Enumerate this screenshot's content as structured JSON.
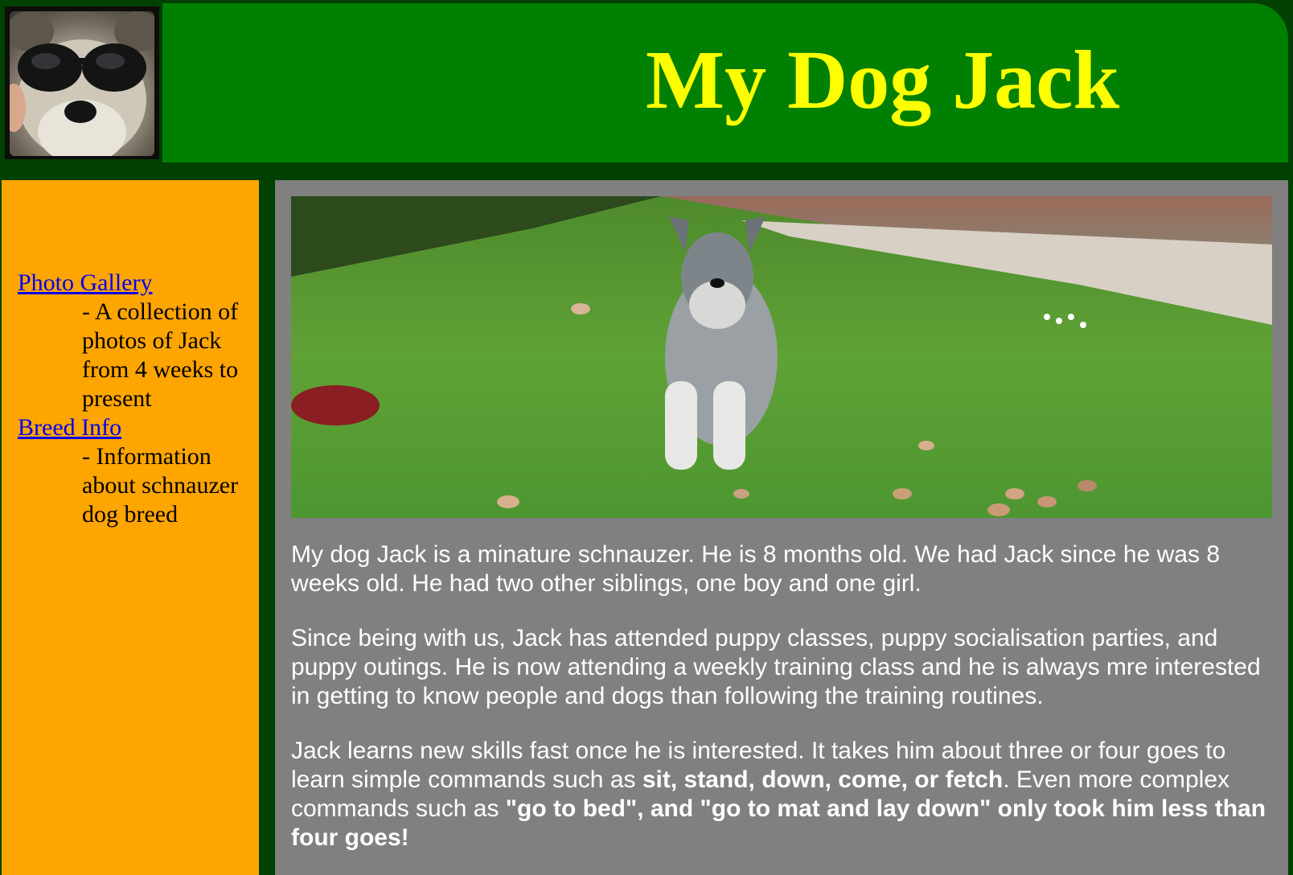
{
  "header": {
    "title": "My Dog Jack",
    "title_color": "#ffff00",
    "bar_color": "#008000",
    "logo_icon": "dog-with-sunglasses-photo"
  },
  "sidebar": {
    "background": "#ffa500",
    "items": [
      {
        "link": "Photo Gallery",
        "description": "- A collection of photos of Jack from 4 weeks to present"
      },
      {
        "link": "Breed Info",
        "description": "- Information about schnauzer dog breed"
      }
    ]
  },
  "main": {
    "background": "#808080",
    "hero_image": "schnauzer-sitting-on-grass-photo",
    "paragraphs": [
      {
        "text": "My dog Jack is a minature schnauzer. He is 8 months old. We had Jack since he was 8 weeks old. He had two other siblings, one boy and one girl."
      },
      {
        "text": "Since being with us, Jack has attended puppy classes, puppy socialisation parties, and puppy outings. He is now attending a weekly training class and he is always mre interested in getting to know people and dogs than following the training routines."
      },
      {
        "part1": "Jack learns new skills fast once he is interested. It takes him about three or four goes to learn simple commands such as ",
        "bold1": "sit, stand, down, come, or fetch",
        "part2": ". Even more complex commands such as ",
        "bold2": "\"go to bed\", and \"go to mat and lay down\" only took him less than four goes!"
      }
    ]
  }
}
